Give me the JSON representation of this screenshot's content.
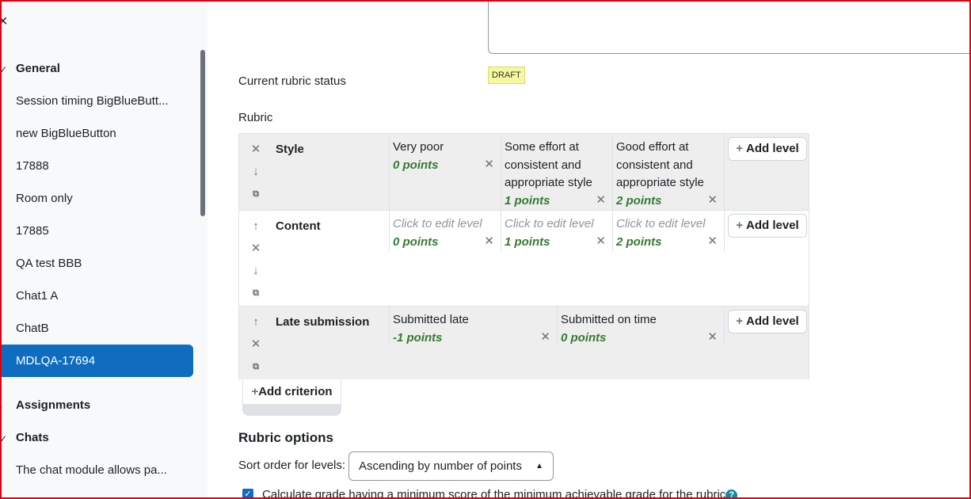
{
  "sidebar": {
    "sections": [
      {
        "label": "General",
        "expanded": true
      },
      {
        "label": "Assignments",
        "expanded": false
      },
      {
        "label": "Chats",
        "expanded": true
      }
    ],
    "items": [
      "Session timing BigBlueButt...",
      "new BigBlueButton",
      "17888",
      "Room only",
      "17885",
      "QA test BBB",
      "Chat1 A",
      "ChatB",
      "MDLQA-17694"
    ],
    "chats_items": [
      "The chat module allows pa..."
    ],
    "active_item": "MDLQA-17694"
  },
  "status": {
    "label": "Current rubric status",
    "badge": "DRAFT"
  },
  "rubric": {
    "label": "Rubric",
    "add_level_label": "Add level",
    "add_criterion_label": "Add criterion",
    "criteria": [
      {
        "name": "Style",
        "levels": [
          {
            "definition": "Very poor",
            "points": "0 points"
          },
          {
            "definition": "Some effort at consistent and appropriate style",
            "points": "1 points"
          },
          {
            "definition": "Good effort at consistent and appropriate style",
            "points": "2 points"
          }
        ]
      },
      {
        "name": "Content",
        "levels": [
          {
            "definition": "Click to edit level",
            "points": "0 points",
            "placeholder": true
          },
          {
            "definition": "Click to edit level",
            "points": "1 points",
            "placeholder": true
          },
          {
            "definition": "Click to edit level",
            "points": "2 points",
            "placeholder": true
          }
        ]
      },
      {
        "name": "Late submission",
        "levels": [
          {
            "definition": "Submitted late",
            "points": "-1 points"
          },
          {
            "definition": "Submitted on time",
            "points": "0 points"
          }
        ]
      }
    ]
  },
  "options": {
    "heading": "Rubric options",
    "sort_label": "Sort order for levels:",
    "sort_value": "Ascending by number of points",
    "checkbox_label": "Calculate grade having a minimum score of the minimum achievable grade for the rubric",
    "checkbox_checked": true
  },
  "colors": {
    "accent": "#0f6cbf",
    "points": "#357a32",
    "badge": "#f6f8a0",
    "frame": "#e3000f"
  }
}
